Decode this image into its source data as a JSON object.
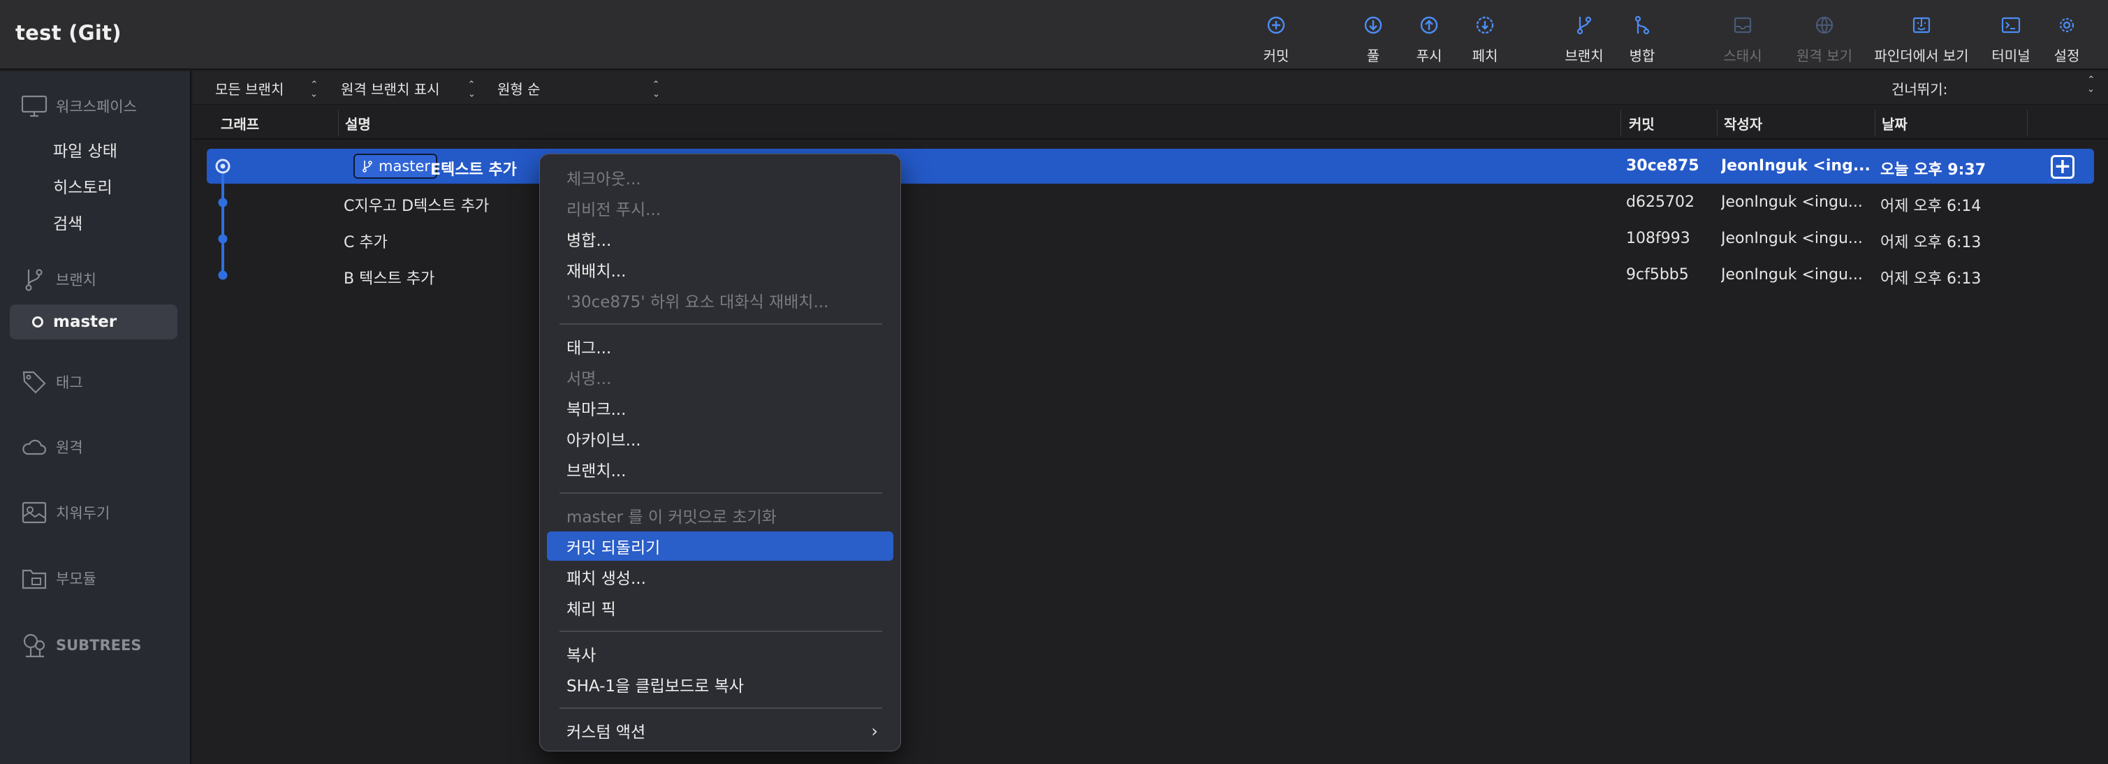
{
  "window": {
    "title": "test (Git)"
  },
  "toolbar": {
    "buttons": [
      {
        "label": "커밋",
        "icon": "plus-circle-icon",
        "disabled": false
      },
      {
        "label": "풀",
        "icon": "arrow-down-circle-icon",
        "disabled": false
      },
      {
        "label": "푸시",
        "icon": "arrow-up-circle-icon",
        "disabled": false
      },
      {
        "label": "페치",
        "icon": "fetch-circle-icon",
        "disabled": false
      },
      {
        "label": "브랜치",
        "icon": "branch-icon",
        "disabled": false
      },
      {
        "label": "병합",
        "icon": "merge-icon",
        "disabled": false
      },
      {
        "label": "스태시",
        "icon": "stash-icon",
        "disabled": true
      },
      {
        "label": "원격 보기",
        "icon": "globe-icon",
        "disabled": true
      },
      {
        "label": "파인더에서 보기",
        "icon": "finder-icon",
        "disabled": false
      },
      {
        "label": "터미널",
        "icon": "terminal-icon",
        "disabled": false
      },
      {
        "label": "설정",
        "icon": "gear-icon",
        "disabled": false
      }
    ]
  },
  "sidebar": {
    "workspace": {
      "label": "워크스페이스",
      "items": [
        "파일 상태",
        "히스토리",
        "검색"
      ]
    },
    "branches": {
      "label": "브랜치",
      "current": "master"
    },
    "tags": {
      "label": "태그"
    },
    "remotes": {
      "label": "원격"
    },
    "stashes": {
      "label": "치워두기"
    },
    "submodules": {
      "label": "부모듈"
    },
    "subtrees": {
      "label": "SUBTREES"
    }
  },
  "filters": {
    "branches": "모든 브랜치",
    "remote": "원격 브랜치 표시",
    "order": "원형 순",
    "skip": "건너뛰기:"
  },
  "columns": {
    "graph": "그래프",
    "description": "설명",
    "commit": "커밋",
    "author": "작성자",
    "date": "날짜"
  },
  "commits": [
    {
      "branch": "master",
      "description": "E텍스트 추가",
      "hash": "30ce875",
      "author": "JeonInguk <ing...",
      "date": "오늘 오후 9:37",
      "selected": true
    },
    {
      "branch": "",
      "description": "C지우고 D텍스트 추가",
      "hash": "d625702",
      "author": "JeonInguk <ingu...",
      "date": "어제 오후 6:14",
      "selected": false
    },
    {
      "branch": "",
      "description": "C 추가",
      "hash": "108f993",
      "author": "JeonInguk <ingu...",
      "date": "어제 오후 6:13",
      "selected": false
    },
    {
      "branch": "",
      "description": "B 텍스트 추가",
      "hash": "9cf5bb5",
      "author": "JeonInguk <ingu...",
      "date": "어제 오후 6:13",
      "selected": false
    }
  ],
  "context_menu": {
    "groups": [
      [
        {
          "label": "체크아웃...",
          "disabled": true
        },
        {
          "label": "리비전 푸시...",
          "disabled": true
        },
        {
          "label": "병합...",
          "disabled": false
        },
        {
          "label": "재배치...",
          "disabled": false
        },
        {
          "label": "'30ce875' 하위 요소 대화식 재배치...",
          "disabled": true
        }
      ],
      [
        {
          "label": "태그...",
          "disabled": false
        },
        {
          "label": "서명...",
          "disabled": true
        },
        {
          "label": "북마크...",
          "disabled": false
        },
        {
          "label": "아카이브...",
          "disabled": false
        },
        {
          "label": "브랜치...",
          "disabled": false
        }
      ],
      [
        {
          "label": "master 를 이 커밋으로 초기화",
          "disabled": true
        },
        {
          "label": "커밋 되돌리기",
          "disabled": false,
          "highlighted": true
        },
        {
          "label": "패치 생성...",
          "disabled": false
        },
        {
          "label": "체리 픽",
          "disabled": false
        }
      ],
      [
        {
          "label": "복사",
          "disabled": false
        },
        {
          "label": "SHA-1을 클립보드로 복사",
          "disabled": false
        }
      ],
      [
        {
          "label": "커스텀 액션",
          "disabled": false,
          "submenu": true
        }
      ]
    ]
  },
  "colors": {
    "selection": "#2459c8",
    "accent_icon": "#4d8df5",
    "graph": "#2f6fe0",
    "menu_highlight": "#2a5ec8"
  }
}
